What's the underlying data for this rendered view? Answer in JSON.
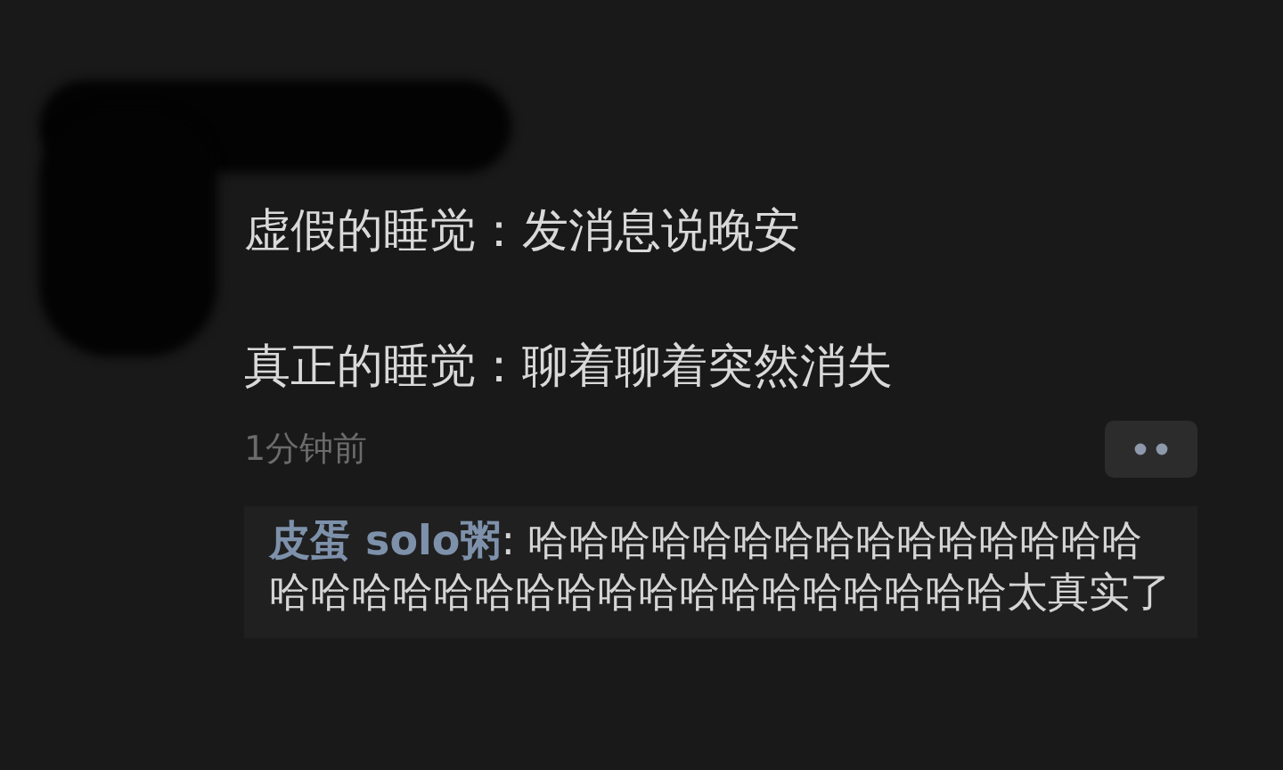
{
  "post": {
    "lines": [
      "虚假的睡觉：发消息说晚安",
      "真正的睡觉：聊着聊着突然消失"
    ],
    "time": "1分钟前"
  },
  "comments": [
    {
      "author": "皮蛋 solo粥",
      "separator": ": ",
      "text": "哈哈哈哈哈哈哈哈哈哈哈哈哈哈哈哈哈哈哈哈哈哈哈哈哈哈哈哈哈哈哈哈哈太真实了"
    }
  ]
}
